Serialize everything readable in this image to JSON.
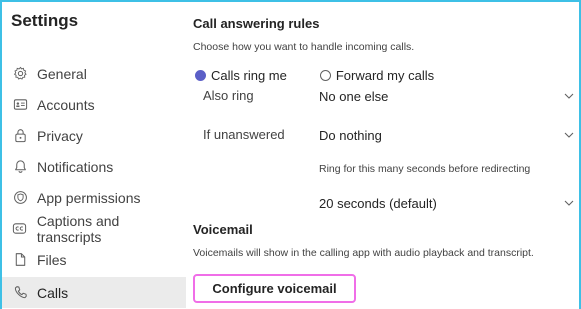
{
  "sidebar": {
    "title": "Settings",
    "items": [
      {
        "label": "General",
        "icon": "gear-icon"
      },
      {
        "label": "Accounts",
        "icon": "id-card-icon"
      },
      {
        "label": "Privacy",
        "icon": "lock-icon"
      },
      {
        "label": "Notifications",
        "icon": "bell-icon"
      },
      {
        "label": "App permissions",
        "icon": "shield-icon"
      },
      {
        "label": "Captions and transcripts",
        "icon": "closed-captions-icon"
      },
      {
        "label": "Files",
        "icon": "file-icon"
      },
      {
        "label": "Calls",
        "icon": "phone-icon",
        "active": true
      }
    ]
  },
  "call_rules": {
    "heading": "Call answering rules",
    "description": "Choose how you want to handle incoming calls.",
    "option_ring": "Calls ring me",
    "option_forward": "Forward my calls",
    "selected": "Calls ring me",
    "also_ring_label": "Also ring",
    "also_ring_value": "No one else",
    "unanswered_label": "If unanswered",
    "unanswered_value": "Do nothing",
    "ring_seconds_label": "Ring for this many seconds before redirecting",
    "ring_seconds_value": "20 seconds (default)"
  },
  "voicemail": {
    "heading": "Voicemail",
    "description": "Voicemails will show in the calling app with audio playback and transcript.",
    "button_label": "Configure voicemail"
  },
  "colors": {
    "accent": "#5b5fc7",
    "frame": "#3ec0e6",
    "focus": "#f06ee8"
  }
}
